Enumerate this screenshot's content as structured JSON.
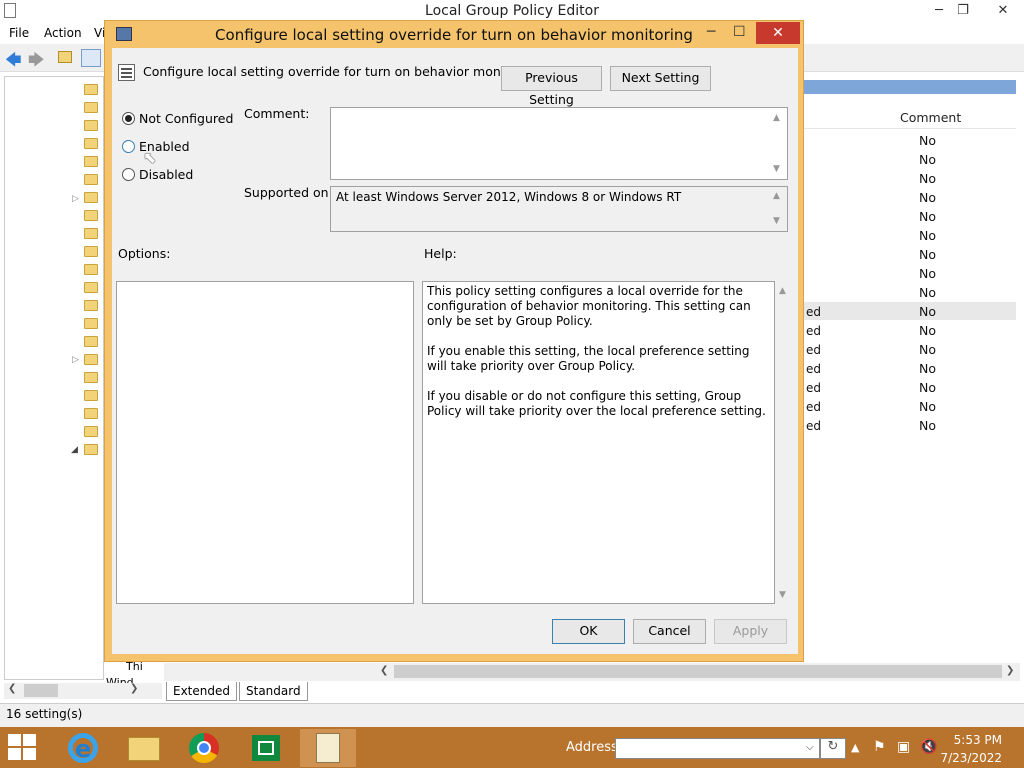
{
  "app": {
    "title": "Local Group Policy Editor"
  },
  "menu": {
    "file": "File",
    "action": "Action",
    "view": "Vi"
  },
  "list": {
    "comment_header": "Comment",
    "rows": [
      "No",
      "No",
      "No",
      "No",
      "No",
      "No",
      "No",
      "No",
      "No",
      "No",
      "No",
      "No",
      "No",
      "No",
      "No",
      "No"
    ],
    "state_fragments": [
      "ed",
      "ed",
      "ed",
      "ed",
      "ed",
      "ed",
      "ed"
    ]
  },
  "tree": {
    "partial_1": "Thi",
    "partial_2": "Wind"
  },
  "tabs": {
    "extended": "Extended",
    "standard": "Standard"
  },
  "status": {
    "text": "16 setting(s)"
  },
  "dialog": {
    "title": "Configure local setting override for turn on behavior monitoring",
    "setting_name": "Configure local setting override for turn on behavior monitoring",
    "prev_button": "Previous Setting",
    "next_button": "Next Setting",
    "radio_not_configured": "Not Configured",
    "radio_enabled": "Enabled",
    "radio_disabled": "Disabled",
    "selected": "Not Configured",
    "comment_label": "Comment:",
    "comment_value": "",
    "supported_label": "Supported on:",
    "supported_value": "At least Windows Server 2012, Windows 8 or Windows RT",
    "options_label": "Options:",
    "help_label": "Help:",
    "help_paragraphs": [
      "This policy setting configures a local override for the configuration of behavior monitoring. This setting can only be set by Group Policy.",
      "If you enable this setting, the local preference setting will take priority over Group Policy.",
      "If you disable or do not configure this setting, Group Policy will take priority over the local preference setting."
    ],
    "ok": "OK",
    "cancel": "Cancel",
    "apply": "Apply"
  },
  "taskbar": {
    "address_label": "Address",
    "address_value": "",
    "time": "5:53 PM",
    "date": "7/23/2022",
    "colors": {
      "taskbar": "#b8732c",
      "dialog_frame": "#f4c36b",
      "close": "#c7382d"
    }
  }
}
